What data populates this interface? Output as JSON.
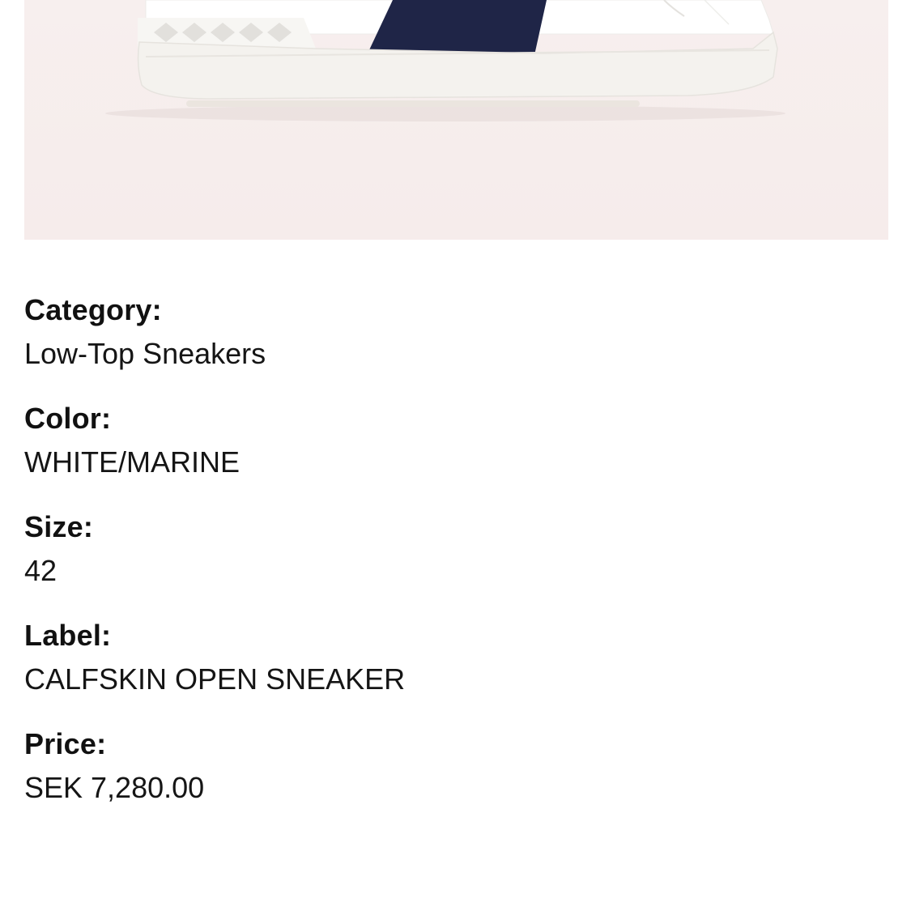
{
  "product": {
    "image_icon": "sneaker-image",
    "colors": {
      "background": "#f6edec",
      "upper": "#ffffff",
      "stripe": "#1f2547",
      "sole": "#f4f2ee"
    }
  },
  "details": [
    {
      "label": "Category:",
      "value": "Low-Top Sneakers"
    },
    {
      "label": "Color:",
      "value": "WHITE/MARINE"
    },
    {
      "label": "Size:",
      "value": "42"
    },
    {
      "label": "Label:",
      "value": "CALFSKIN OPEN SNEAKER"
    },
    {
      "label": "Price:",
      "value": "SEK 7,280.00"
    }
  ]
}
